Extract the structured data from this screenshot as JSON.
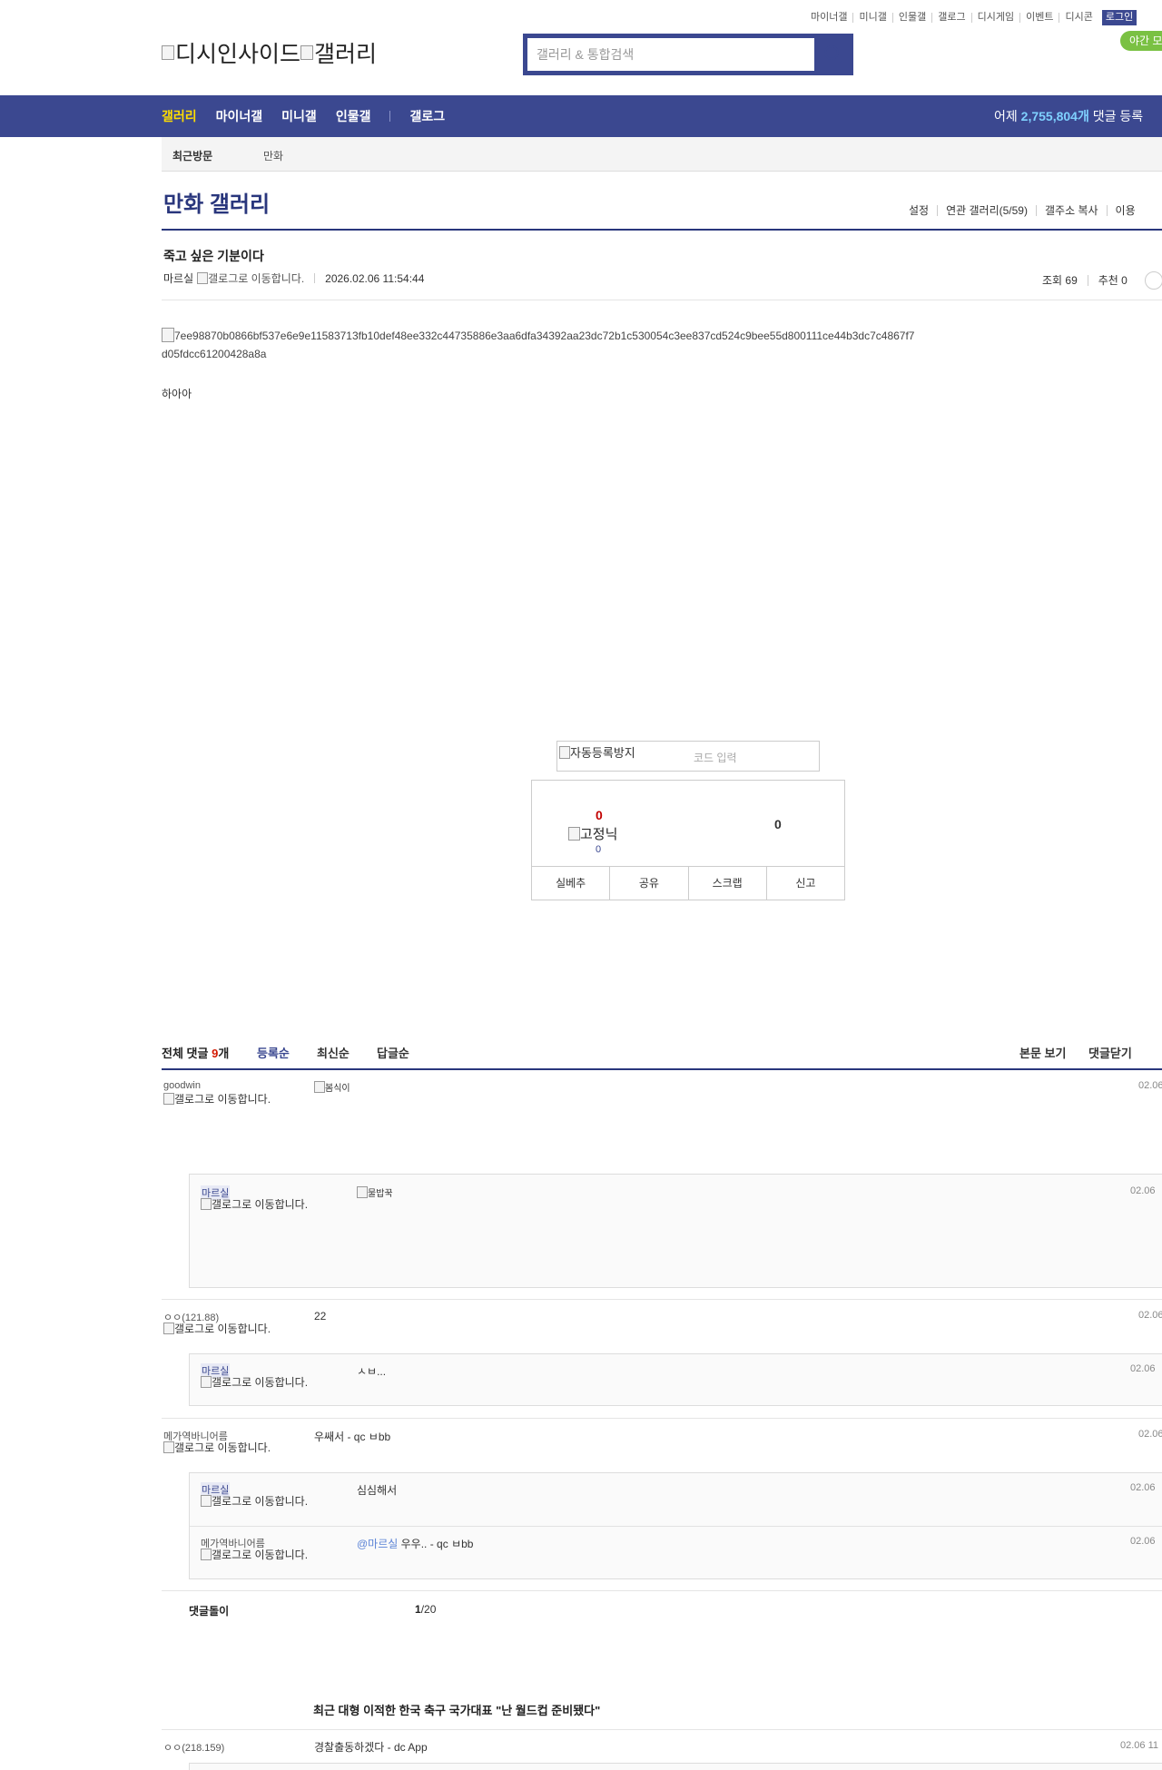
{
  "header": {
    "top_links": [
      "마이너갤",
      "미니갤",
      "인물갤",
      "갤로그",
      "디시게임",
      "이벤트",
      "디시콘"
    ],
    "login_label": "로그인",
    "night_label": "야간 모드",
    "logo_text_1": "디시인사이드",
    "logo_text_2": "갤러리",
    "search_placeholder": "갤러리 & 통합검색"
  },
  "gnb": {
    "items": [
      "갤러리",
      "마이너갤",
      "미니갤",
      "인물갤",
      "갤로그"
    ],
    "stat_prefix": "어제",
    "stat_count": "2,755,804개",
    "stat_suffix": "댓글 등록"
  },
  "visit": {
    "label": "최근방문",
    "item": "만화"
  },
  "gallery": {
    "title": "만화 갤러리",
    "tools": [
      "설정",
      "연관 갤러리(5/59)",
      "갤주소 복사",
      "이용"
    ]
  },
  "post": {
    "title": "죽고 싶은 기분이다",
    "author": "마르실",
    "gallog_alt": "갤로그로 이동합니다.",
    "date": "2026.02.06 11:54:44",
    "views": "조회 69",
    "recommends": "추천 0",
    "image_alt_1": "7ee98870b0866bf537e6e9e11583713fb10def48ee332c44735886e3aa6dfa34392aa23dc72b1c530054c3ee837cd524c9bee55d800111ce44b3dc7c4867f7",
    "image_alt_2": "d05fdcc61200428a8a",
    "body": "하아아"
  },
  "captcha": {
    "label": "자동등록방지",
    "placeholder": "코드 입력"
  },
  "recommend": {
    "up_count": "0",
    "fixed_label": "고정닉",
    "fixed_count": "0",
    "down_count": "0",
    "buttons": [
      "실베추",
      "공유",
      "스크랩",
      "신고"
    ]
  },
  "comments_header": {
    "total_label": "전체 댓글",
    "total_count": "9",
    "total_unit": "개",
    "sorts": [
      "등록순",
      "최신순",
      "답글순"
    ],
    "right": [
      "본문 보기",
      "댓글닫기"
    ]
  },
  "comments": [
    {
      "nick": "goodwin",
      "gallog": "갤로그로 이동합니다.",
      "dccon": "봄식이",
      "date": "02.06"
    },
    {
      "nick": "마르실",
      "gallog": "갤로그로 이동합니다.",
      "dccon": "물밥꾹",
      "date": "02.06"
    },
    {
      "nick": "ㅇㅇ(121.88)",
      "gallog": "갤로그로 이동합니다.",
      "text": "22",
      "date": "02.06"
    },
    {
      "nick": "마르실",
      "gallog": "갤로그로 이동합니다.",
      "text": "ㅅㅂ...",
      "date": "02.06"
    },
    {
      "nick": "메가역바니어름",
      "gallog": "갤로그로 이동합니다.",
      "text": "우쌔서 - qc ㅂbb",
      "date": "02.06"
    },
    {
      "nick": "마르실",
      "gallog": "갤로그로 이동합니다.",
      "text": "심심해서",
      "date": "02.06"
    },
    {
      "nick": "메가역바니어름",
      "gallog": "갤로그로 이동합니다.",
      "at": "@마르실",
      "text": " 우우.. - qc ㅂbb",
      "date": "02.06"
    }
  ],
  "footer": {
    "cleanbot": "댓글돌이",
    "page_current": "1",
    "page_total": "/20",
    "news_title": "최근 대형 이적한 한국 축구 국가대표 \"난 월드컵 준비됐다\"",
    "list_nick": "ㅇㅇ(218.159)",
    "list_text": "경찰출동하겠다 - dc App",
    "list_date": "02.06 11"
  }
}
